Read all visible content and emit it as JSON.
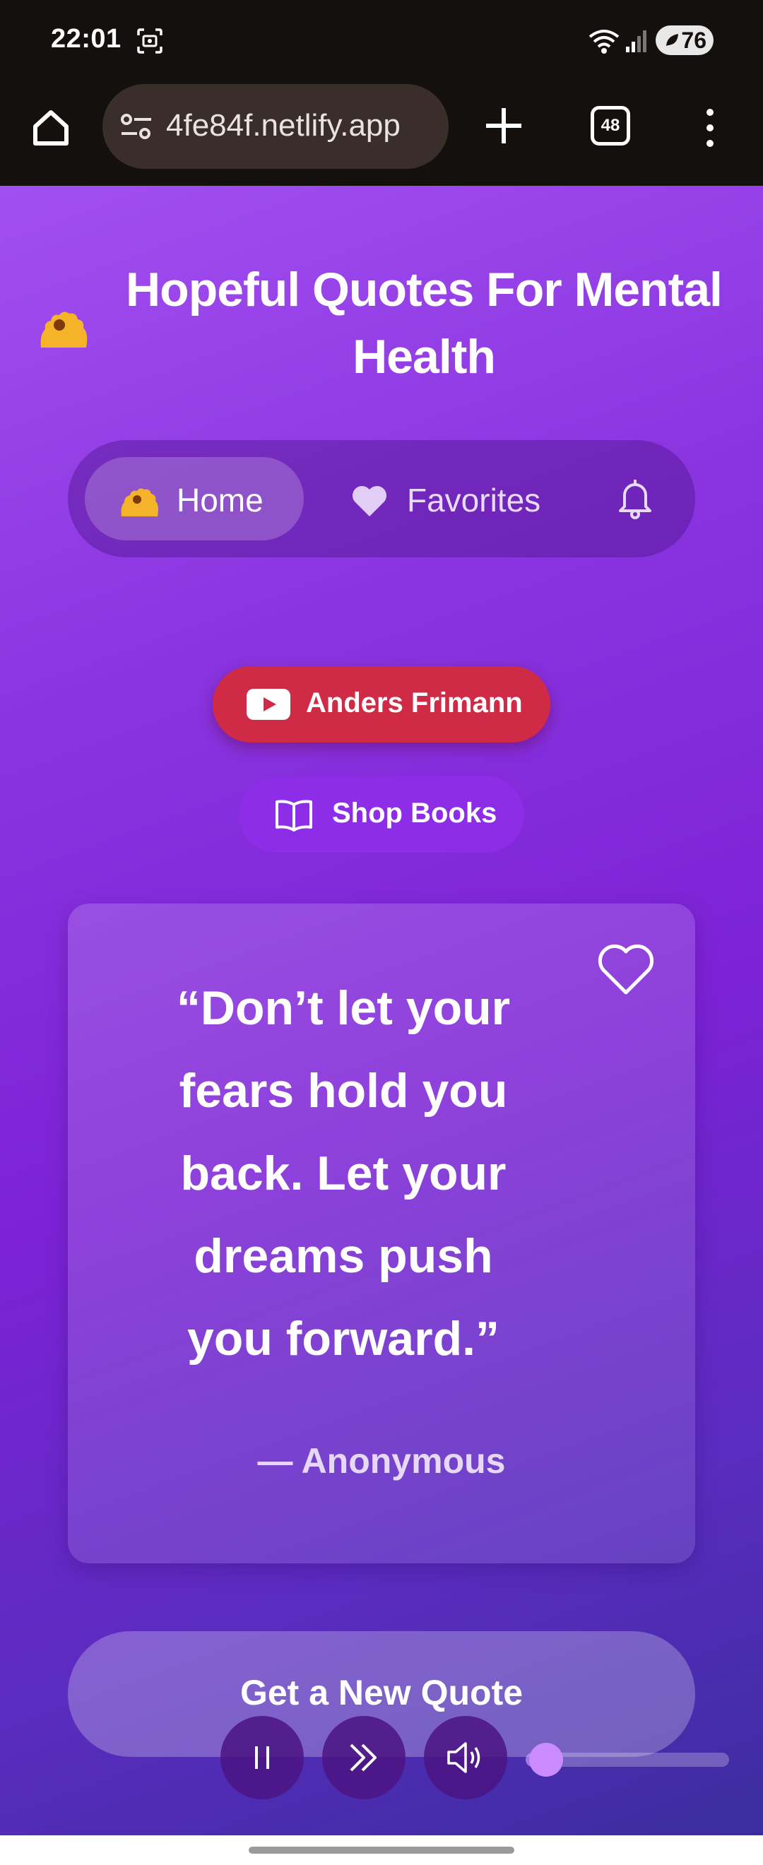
{
  "status_bar": {
    "time": "22:01",
    "battery_level": "76"
  },
  "browser": {
    "url": "4fe84f.netlify.app",
    "tab_count": "48"
  },
  "page": {
    "title": "Hopeful Quotes For Mental Health",
    "nav": {
      "home_label": "Home",
      "favorites_label": "Favorites"
    },
    "youtube_button_label": "Anders Frimann",
    "shop_button_label": "Shop Books",
    "quote": {
      "text": "“Don’t let your fears hold you back. Let your dreams push you forward.”",
      "author": "— Anonymous"
    },
    "new_quote_button_label": "Get a New Quote",
    "player": {
      "volume_level": 0.1
    }
  },
  "colors": {
    "accent_purple": "#8a34e0",
    "youtube_red": "#cf2b46",
    "sun_yellow": "#f5b32a"
  },
  "icons": [
    "screenshot-icon",
    "wifi-icon",
    "signal-icon",
    "battery-icon",
    "home-icon",
    "site-settings-icon",
    "plus-icon",
    "tabs-icon",
    "more-vert-icon",
    "sun-icon",
    "heart-icon",
    "bell-icon",
    "youtube-icon",
    "book-icon",
    "pause-icon",
    "fast-forward-icon",
    "volume-icon"
  ]
}
